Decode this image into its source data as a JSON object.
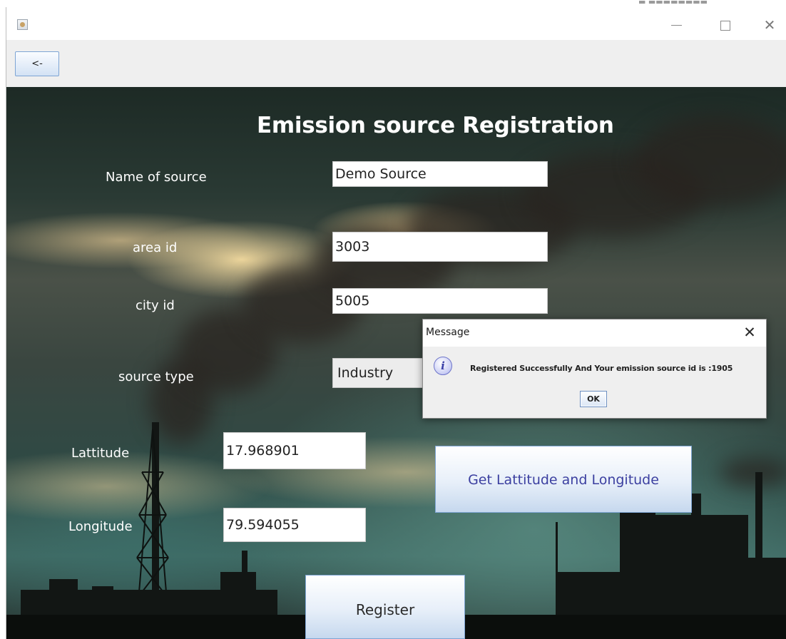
{
  "window": {
    "desktop_text": "▬ ▬▬▬▬▬▬▬▬",
    "minimize_icon": "minimize-icon",
    "maximize_icon": "maximize-icon",
    "close_glyph": "✕"
  },
  "toolbar": {
    "back_label": "<-"
  },
  "form": {
    "title": "Emission source Registration",
    "fields": {
      "name": {
        "label": "Name of source",
        "value": "Demo Source"
      },
      "area": {
        "label": "area id",
        "value": "3003"
      },
      "city": {
        "label": "city id",
        "value": "5005"
      },
      "source_type": {
        "label": "source type",
        "value": "Industry"
      },
      "latitude": {
        "label": "Lattitude",
        "value": "17.968901"
      },
      "longitude": {
        "label": "Longitude",
        "value": "79.594055"
      }
    },
    "get_location_button": "Get Lattitude and Longitude",
    "register_button": "Register"
  },
  "dialog": {
    "title": "Message",
    "close_glyph": "✕",
    "icon": "info-icon",
    "icon_glyph": "i",
    "message": "Registered Successfully And Your emission source id is :1905",
    "ok_label": "OK"
  },
  "colors": {
    "button_gradient_top": "#ffffff",
    "button_gradient_bottom": "#c6d8ee",
    "button_border": "#7ea5d4",
    "link_text": "#3b3fa0"
  }
}
